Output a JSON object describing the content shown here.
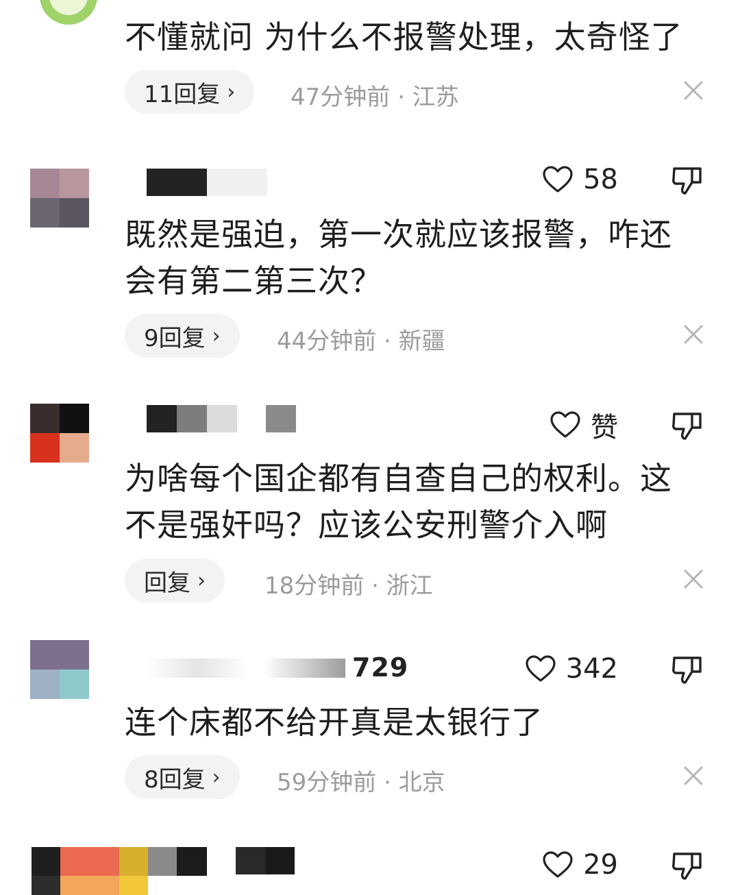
{
  "comments": [
    {
      "text": "不懂就问 为什么不报警处理，太奇怪了",
      "replies": "11回复",
      "time_location": "47分钟前 · 江苏"
    },
    {
      "likes": "58",
      "text": "既然是强迫，第一次就应该报警，咋还会有第二第三次？",
      "replies": "9回复",
      "time_location": "44分钟前 · 新疆"
    },
    {
      "likes": "赞",
      "text": "为啥每个国企都有自查自己的权利。这不是强奸吗？应该公安刑警介入啊",
      "replies": "回复",
      "time_location": "18分钟前 · 浙江"
    },
    {
      "username_visible": "729",
      "likes": "342",
      "text": "连个床都不给开真是太银行了",
      "replies": "8回复",
      "time_location": "59分钟前 · 北京"
    },
    {
      "likes": "29"
    }
  ],
  "icons": {
    "like": "heart-outline-icon",
    "dislike": "thumbs-down-icon",
    "reply_arrow": "chevron-right-icon",
    "dismiss": "close-icon"
  },
  "colors": {
    "meta_text": "#9b9b9b",
    "reply_bg": "#f3f3f3"
  }
}
